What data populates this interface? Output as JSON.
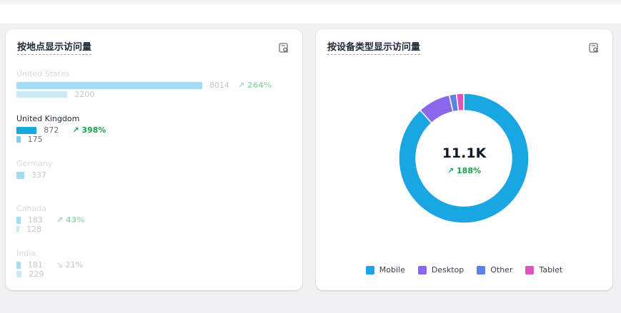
{
  "left_card": {
    "title": "按地点显示访问量",
    "icon": "search-report-icon"
  },
  "right_card": {
    "title": "按设备类型显示访问量",
    "icon": "search-report-icon",
    "total": "11.1K",
    "change": "↗ 188%"
  },
  "colors": {
    "bar_current": "#1aa6e2",
    "bar_previous": "#7fcdee",
    "increase": "#16a34a",
    "decrease": "#6b7280",
    "mobile": "#1aa6e2",
    "desktop": "#8b67ee",
    "other": "#5a83e6",
    "tablet": "#dd55bb"
  },
  "chart_data": [
    {
      "type": "bar",
      "orientation": "horizontal",
      "categories": [
        "United States",
        "United Kingdom",
        "Germany",
        "Canada",
        "India"
      ],
      "series": [
        {
          "values": [
            8014,
            872,
            337,
            183,
            181
          ]
        },
        {
          "values": [
            2200,
            175,
            null,
            128,
            229
          ]
        }
      ],
      "change_labels": [
        "↗ 264%",
        "↗ 398%",
        "",
        "↗ 43%",
        "↘ 21%"
      ],
      "highlighted": "United Kingdom"
    },
    {
      "type": "pie",
      "subtype": "donut",
      "labels": [
        "Mobile",
        "Desktop",
        "Other",
        "Tablet"
      ],
      "values": [
        9800,
        900,
        200,
        200
      ],
      "center_value": "11.1K",
      "center_change": "↗ 188%",
      "legend_position": "bottom"
    }
  ]
}
